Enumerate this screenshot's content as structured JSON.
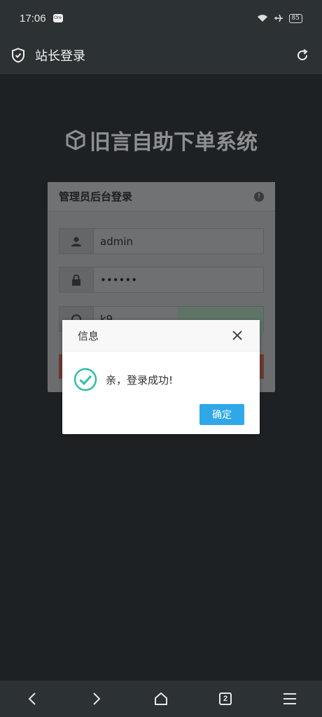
{
  "status": {
    "time": "17:06",
    "battery": "85",
    "notif": "Ore"
  },
  "appbar": {
    "title": "站长登录"
  },
  "brand": {
    "title": "旧言自助下单系统"
  },
  "login_card": {
    "header": "管理员后台登录",
    "username": "admin",
    "password": "••••••",
    "captcha_partial": "k9"
  },
  "dialog": {
    "title": "信息",
    "message": "亲，登录成功!",
    "confirm_label": "确定"
  },
  "bottom_nav": {
    "tab_count": "2"
  },
  "colors": {
    "accent": "#2fa8e8",
    "success": "#2ec0a4",
    "bar": "#2c3133",
    "bg": "#1e2124"
  }
}
